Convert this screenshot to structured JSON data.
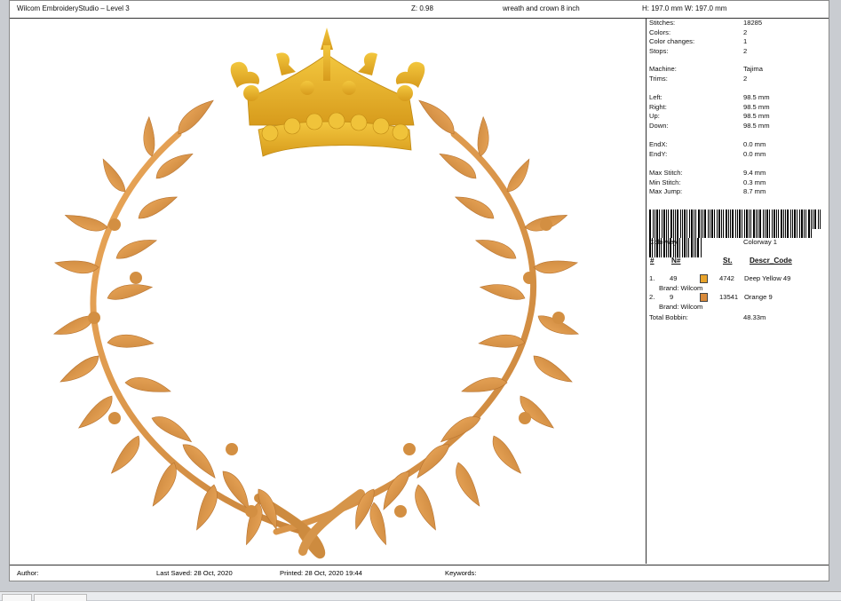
{
  "header": {
    "app_title": "Wilcom EmbroideryStudio – Level 3",
    "zoom": "Z: 0.98",
    "design_name": "wreath and crown 8 inch",
    "size": "H: 197.0 mm   W: 197.0 mm"
  },
  "stats": [
    {
      "label": "Stitches:",
      "value": "18285"
    },
    {
      "label": "Colors:",
      "value": "2"
    },
    {
      "label": "Color changes:",
      "value": "1"
    },
    {
      "label": "Stops:",
      "value": "2"
    },
    {
      "label": "Machine:",
      "value": "Tajima"
    },
    {
      "label": "Trims:",
      "value": "2"
    },
    {
      "label": "Left:",
      "value": "98.5 mm"
    },
    {
      "label": "Right:",
      "value": "98.5 mm"
    },
    {
      "label": "Up:",
      "value": "98.5 mm"
    },
    {
      "label": "Down:",
      "value": "98.5 mm"
    },
    {
      "label": "EndX:",
      "value": "0.0 mm"
    },
    {
      "label": "EndY:",
      "value": "0.0 mm"
    },
    {
      "label": "Max Stitch:",
      "value": "9.4 mm"
    },
    {
      "label": "Min Stitch:",
      "value": "0.3 mm"
    },
    {
      "label": "Max Jump:",
      "value": "8.7 mm"
    }
  ],
  "colorway": {
    "label": "Colorway:",
    "value": "Colorway 1"
  },
  "color_table": {
    "headers": {
      "index": "#",
      "number": "N#",
      "stitches": "St.",
      "descr": "Descr_Code"
    },
    "rows": [
      {
        "index": "1.",
        "number": "49",
        "swatch_color": "#e8a32a",
        "stitches": "4742",
        "descr": "Deep Yellow 49",
        "brand": "Brand: Wilcom"
      },
      {
        "index": "2.",
        "number": "9",
        "swatch_color": "#d98a3a",
        "stitches": "13541",
        "descr": "Orange 9",
        "brand": "Brand: Wilcom"
      }
    ],
    "total_bobbin_label": "Total Bobbin:",
    "total_bobbin_value": "48.33m"
  },
  "footer": {
    "author": "Author:",
    "last_saved": "Last Saved: 28 Oct, 2020",
    "printed": "Printed: 28 Oct, 2020 19:44",
    "keywords": "Keywords:"
  },
  "colors": {
    "crown": "#e8b52e",
    "wreath": "#dc9a48"
  }
}
